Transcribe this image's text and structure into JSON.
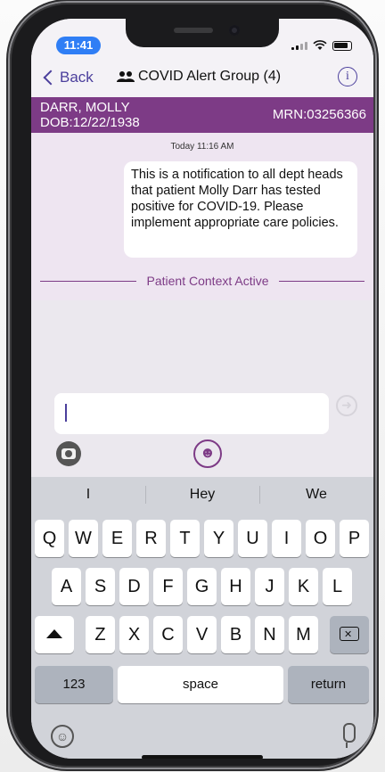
{
  "status_bar": {
    "time": "11:41"
  },
  "nav": {
    "back_label": "Back",
    "title": "COVID Alert Group (4)",
    "info_label": "i"
  },
  "patient": {
    "name": "DARR, MOLLY",
    "dob": "DOB:12/22/1938",
    "mrn": "MRN:03256366"
  },
  "chat": {
    "timestamp": "Today 11:16 AM",
    "message": "This is a notification to all dept heads that patient Molly Darr has tested positive for COVID-19. Please implement appropriate care policies.",
    "context_label": "Patient Context Active"
  },
  "composer": {
    "placeholder": "",
    "send_icon": "arrow-right-circle-icon"
  },
  "keyboard": {
    "suggestions": [
      "I",
      "Hey",
      "We"
    ],
    "row1": [
      "Q",
      "W",
      "E",
      "R",
      "T",
      "Y",
      "U",
      "I",
      "O",
      "P"
    ],
    "row2": [
      "A",
      "S",
      "D",
      "F",
      "G",
      "H",
      "J",
      "K",
      "L"
    ],
    "row3": [
      "Z",
      "X",
      "C",
      "V",
      "B",
      "N",
      "M"
    ],
    "numbers_label": "123",
    "space_label": "space",
    "return_label": "return"
  },
  "colors": {
    "brand_purple": "#7d3b86",
    "nav_purple": "#4b3f9c",
    "time_pill": "#2f7ef5"
  }
}
